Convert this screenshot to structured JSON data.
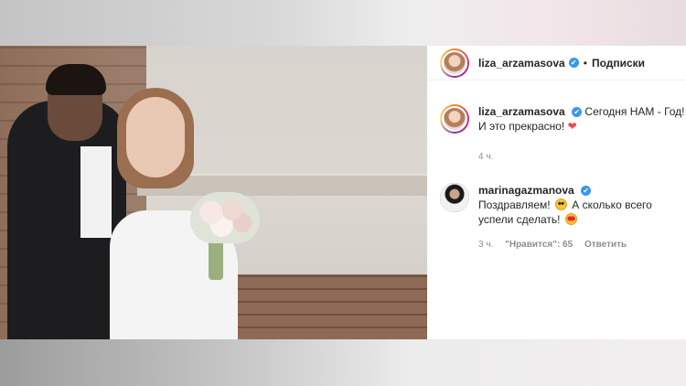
{
  "post": {
    "author": {
      "username": "liza_arzamasova",
      "verified_glyph": "✔",
      "avatar_icon": "profile-avatar-icon"
    },
    "header": {
      "separator": "•",
      "follow_label": "Подписки"
    },
    "caption": {
      "username": "liza_arzamasova",
      "text_line1": "Сегодня НАМ - Год!",
      "text_line2": "И это прекрасно!",
      "heart_glyph": "❤",
      "time": "4 ч."
    },
    "comments": [
      {
        "username": "marinagazmanova",
        "text_line1": "Поздравляем!",
        "text_line1b": "А сколько всего",
        "text_line2": "успели сделать!",
        "time": "3 ч.",
        "likes_label": "\"Нравится\": 65",
        "reply_label": "Ответить"
      }
    ],
    "photo": {
      "description_icon": "wedding-photo"
    }
  },
  "colors": {
    "verified": "#3897f0",
    "heart": "#ed4956",
    "text": "#262626",
    "muted": "#8e8e8e"
  }
}
